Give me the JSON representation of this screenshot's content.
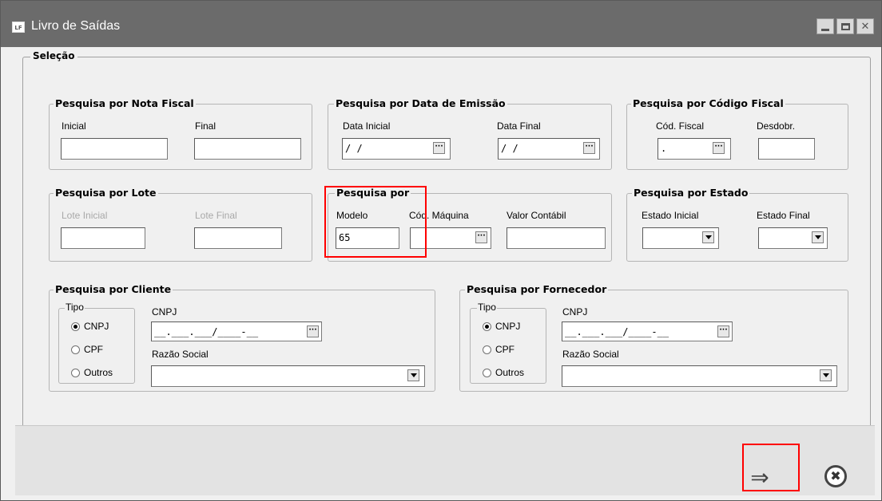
{
  "window": {
    "logo_text": "LF",
    "title": "Livro de Saídas"
  },
  "selecao": {
    "legend": "Seleção"
  },
  "nota_fiscal": {
    "legend": "Pesquisa por Nota Fiscal",
    "inicial_label": "Inicial",
    "final_label": "Final",
    "inicial_value": "",
    "final_value": ""
  },
  "data_emissao": {
    "legend": "Pesquisa por Data de Emissão",
    "data_inicial_label": "Data Inicial",
    "data_final_label": "Data Final",
    "data_inicial_value": "/ /",
    "data_final_value": "/ /"
  },
  "codigo_fiscal": {
    "legend": "Pesquisa por Código Fiscal",
    "cod_fiscal_label": "Cód. Fiscal",
    "desdobr_label": "Desdobr.",
    "cod_fiscal_value": ".",
    "desdobr_value": ""
  },
  "lote": {
    "legend": "Pesquisa por Lote",
    "lote_inicial_label": "Lote Inicial",
    "lote_final_label": "Lote Final"
  },
  "pesquisa_por": {
    "legend": "Pesquisa por",
    "modelo_label": "Modelo",
    "cod_maquina_label": "Cód. Máquina",
    "valor_contabil_label": "Valor Contábil",
    "modelo_value": "65",
    "cod_maquina_value": "",
    "valor_contabil_value": ""
  },
  "estado": {
    "legend": "Pesquisa por Estado",
    "estado_inicial_label": "Estado Inicial",
    "estado_final_label": "Estado Final"
  },
  "cliente": {
    "legend": "Pesquisa por Cliente",
    "tipo_legend": "Tipo",
    "radio_cnpj": "CNPJ",
    "radio_cpf": "CPF",
    "radio_outros": "Outros",
    "cnpj_label": "CNPJ",
    "cnpj_value": "__.___.___/____-__",
    "razao_social_label": "Razão Social"
  },
  "fornecedor": {
    "legend": "Pesquisa por Fornecedor",
    "tipo_legend": "Tipo",
    "radio_cnpj": "CNPJ",
    "radio_cpf": "CPF",
    "radio_outros": "Outros",
    "cnpj_label": "CNPJ",
    "cnpj_value": "__.___.___/____-__",
    "razao_social_label": "Razão Social"
  },
  "icons": {
    "ellipsis": "···",
    "execute": "⇒",
    "cancel": "✖"
  },
  "colors": {
    "titlebar": "#6b6b6b",
    "window_bg": "#f0f0f0",
    "highlight": "#ff0000"
  }
}
